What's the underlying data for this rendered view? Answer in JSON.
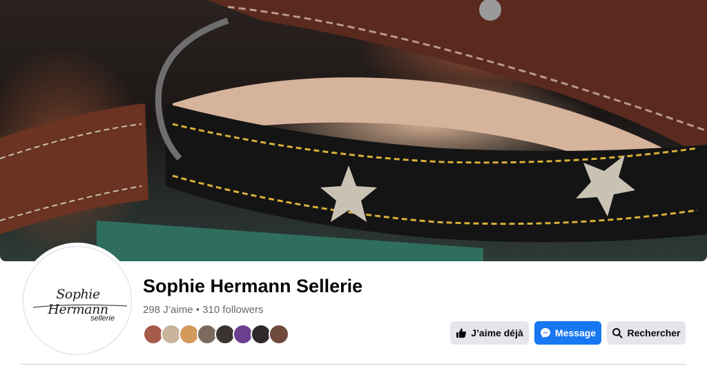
{
  "page": {
    "name": "Sophie Hermann Sellerie",
    "likes_count": "298 J’aime",
    "separator": "•",
    "followers_count": "310 followers"
  },
  "logo": {
    "main_text": "Sophie Hermann",
    "sub_text": "sellerie"
  },
  "actions": {
    "like_label": "J’aime déjà",
    "message_label": "Message",
    "search_label": "Rechercher"
  },
  "icons": {
    "like": "thumbs-up-icon",
    "message": "messenger-icon",
    "search": "search-icon"
  },
  "friends": [
    {
      "color": "#a65a4a"
    },
    {
      "color": "#c7b49a"
    },
    {
      "color": "#d39a5c"
    },
    {
      "color": "#7c6a5e"
    },
    {
      "color": "#3b3330"
    },
    {
      "color": "#6c3f8f"
    },
    {
      "color": "#2e2a2b"
    },
    {
      "color": "#6f4b3d"
    }
  ],
  "colors": {
    "primary": "#1877f2",
    "secondary_button": "#e4e6eb",
    "text_primary": "#050505",
    "text_secondary": "#65676b"
  }
}
